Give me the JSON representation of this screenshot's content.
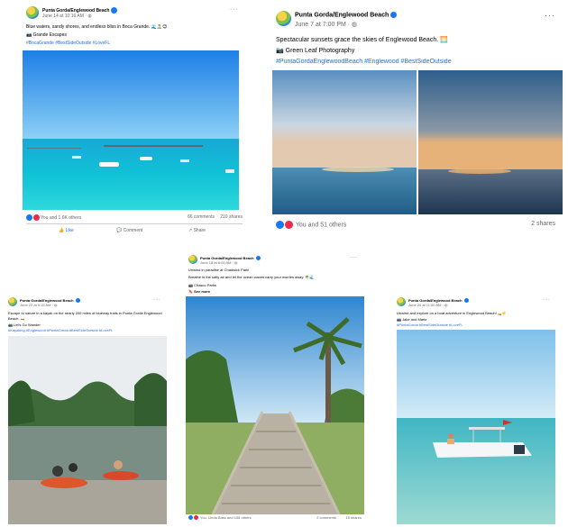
{
  "page_name": "Punta Gorda/Englewood Beach",
  "posts": {
    "p1": {
      "date": "June 14 at 10:16 AM · ",
      "line1": "Blue waters, sandy shores, and endless bliss in Boca Grande. 🌊🏝️😊",
      "line2": "📷 Grande Escapes",
      "tags": "#BocaGrande #BestSideOutside #LoveFL",
      "reactions": "You and 1.6K others",
      "comments": "66 comments",
      "shares": "210 shares",
      "like": "Like",
      "comment": "Comment",
      "share": "Share"
    },
    "p2": {
      "date": "June 7 at 7:00 PM · ",
      "line1": "Spectacular sunsets grace the skies of Englewood Beach. 🌅",
      "line2": "📷 Green Leaf Photography",
      "tags": "#PuntaGordaEnglewoodBeach #Englewood #BestSideOutside",
      "reactions": "You and 51 others",
      "shares": "2 shares"
    },
    "p3": {
      "date": "June 22 at 9:15 AM · ",
      "line1": "Escape to nature in a kayak on the nearly 200 miles of blueway trails in Punta Gorda Englewood",
      "line2": "Beach. 🛶",
      "line3": "📷 Let's Go Wander",
      "tags": "#Kayaking #Englewood #PuntaGorda #BestSideOutside #LoveFL"
    },
    "p4": {
      "date": "June 18 at 8:00 AM · ",
      "line1": "Unwind in paradise at Chadwick Park!",
      "line2": "Breathe in the salty air and let the ocean waves carry your worries away. 🌴🌊",
      "line3": "📷 Chasco Parks",
      "see_more": "🔖 See more",
      "reactions": "You, Linda Bass and 158 others",
      "comments": "2 comments",
      "shares": "15 shares"
    },
    "p5": {
      "date": "June 20 at 11:00 AM · ",
      "line1": "Unwind and explore on a boat adventure in Englewood Beach! 🚤☀️",
      "line2": "📷 Jake and Marie",
      "tags": "#PuntaGorda #BestSideOutside #LoveFL"
    }
  },
  "icons": [
    "verified-badge-icon",
    "globe-icon",
    "more-options-icon",
    "like-icon",
    "comment-icon",
    "share-icon"
  ]
}
